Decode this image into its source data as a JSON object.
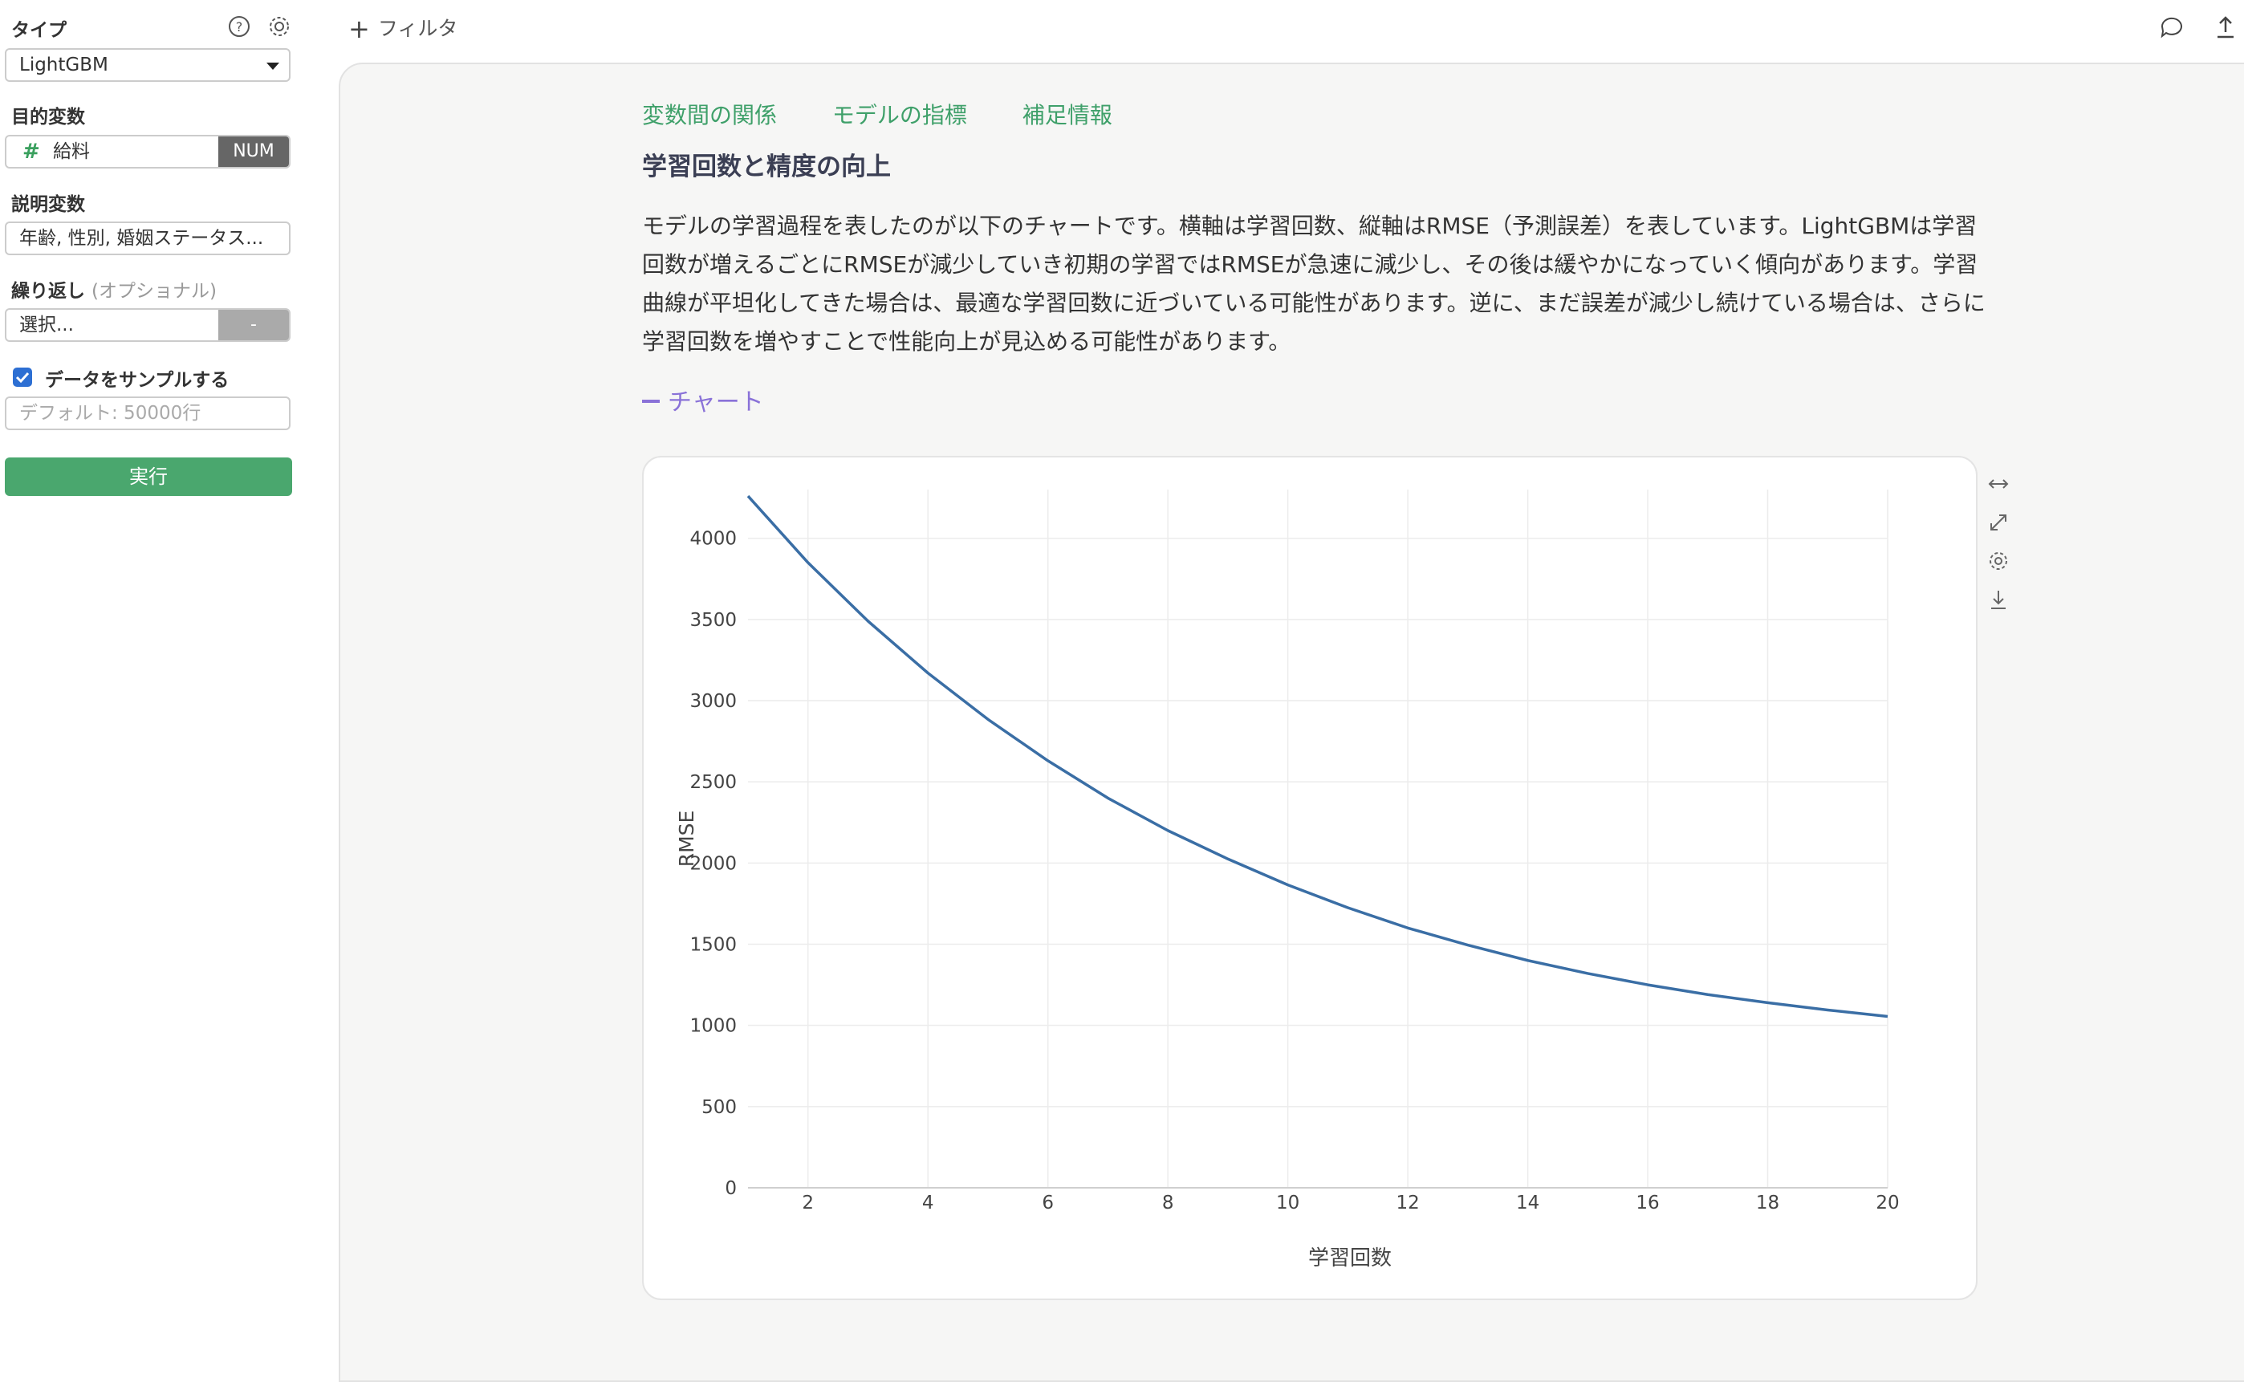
{
  "sidebar": {
    "type_label": "タイプ",
    "type_value": "LightGBM",
    "target_label": "目的変数",
    "target_value": "給料",
    "target_tag": "NUM",
    "explanatory_label": "説明変数",
    "explanatory_value": "年齢, 性別, 婚姻ステータス...",
    "repeat_label": "繰り返し",
    "repeat_optional": "(オプショナル)",
    "repeat_placeholder": "選択...",
    "repeat_tag": "-",
    "sample_label": "データをサンプルする",
    "sample_checked": true,
    "sample_placeholder": "デフォルト: 50000行",
    "run_label": "実行"
  },
  "topbar": {
    "filter_label": "フィルタ"
  },
  "main": {
    "tabs": [
      "変数間の関係",
      "モデルの指標",
      "補足情報"
    ],
    "section_title": "学習回数と精度の向上",
    "description": "モデルの学習過程を表したのが以下のチャートです。横軸は学習回数、縦軸はRMSE（予測誤差）を表しています。LightGBMは学習回数が増えるごとにRMSEが減少していき初期の学習ではRMSEが急速に減少し、その後は緩やかになっていく傾向があります。学習曲線が平坦化してきた場合は、最適な学習回数に近づいている可能性があります。逆に、まだ誤差が減少し続けている場合は、さらに学習回数を増やすことで性能向上が見込める可能性があります。",
    "chart_toggle_label": "チャート"
  },
  "colors": {
    "accent_green": "#4aa76e",
    "tab_green": "#3fa06a",
    "toggle_purple": "#8a72d8",
    "line_blue": "#3a6ea5"
  },
  "chart_data": {
    "type": "line",
    "xlabel": "学習回数",
    "ylabel": "RMSE",
    "x": [
      1,
      2,
      3,
      4,
      5,
      6,
      7,
      8,
      9,
      10,
      11,
      12,
      13,
      14,
      15,
      16,
      17,
      18,
      19,
      20
    ],
    "series": [
      {
        "values": [
          4260,
          3850,
          3490,
          3170,
          2885,
          2630,
          2400,
          2200,
          2025,
          1865,
          1725,
          1600,
          1495,
          1400,
          1320,
          1250,
          1190,
          1140,
          1095,
          1055
        ]
      }
    ],
    "xticks": [
      2,
      4,
      6,
      8,
      10,
      12,
      14,
      16,
      18,
      20
    ],
    "yticks": [
      0,
      500,
      1000,
      1500,
      2000,
      2500,
      3000,
      3500,
      4000
    ],
    "xlim": [
      1,
      20
    ],
    "ylim": [
      0,
      4300
    ],
    "grid": true
  }
}
